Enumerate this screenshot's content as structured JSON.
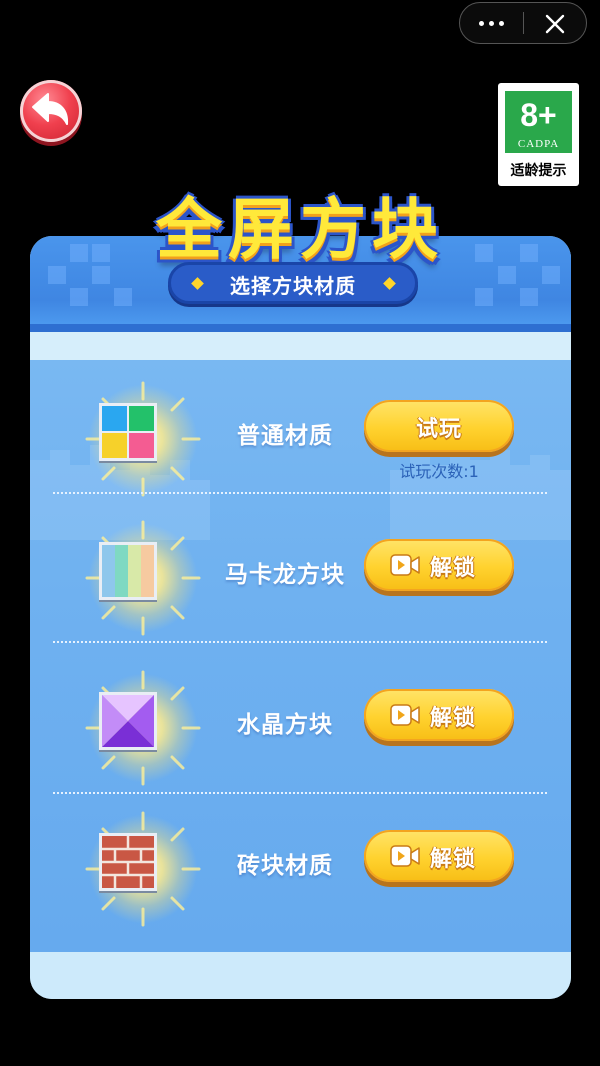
{
  "capsule": {
    "more_icon": "more-dots-icon",
    "close_icon": "close-icon"
  },
  "back_button": {
    "icon": "back-arrow-icon",
    "color": "#f0404e"
  },
  "age_rating": {
    "rating": "8+",
    "org": "CADPA",
    "label": "适龄提示",
    "color": "#2aa84b"
  },
  "header": {
    "title": "全屏方块",
    "subtitle": "选择方块材质"
  },
  "materials": [
    {
      "name": "普通材质",
      "button_label": "试玩",
      "trial_text": "试玩次数:1",
      "tile_icon": "four-color-block-icon"
    },
    {
      "name": "马卡龙方块",
      "button_label": "解锁",
      "button_icon": "video-icon",
      "tile_icon": "macaron-block-icon"
    },
    {
      "name": "水晶方块",
      "button_label": "解锁",
      "button_icon": "video-icon",
      "tile_icon": "crystal-block-icon"
    },
    {
      "name": "砖块材质",
      "button_label": "解锁",
      "button_icon": "video-icon",
      "tile_icon": "brick-block-icon"
    }
  ],
  "colors": {
    "button_yellow": "#ffd22e",
    "panel_blue": "#6fb1f0",
    "title_yellow": "#ffe93a"
  }
}
